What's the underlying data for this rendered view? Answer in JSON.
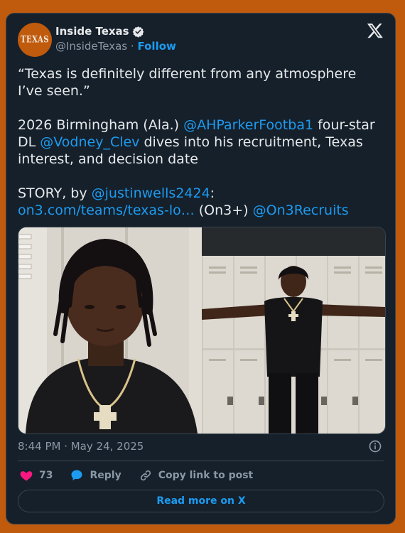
{
  "author": {
    "display_name": "Inside Texas",
    "handle": "@InsideTexas",
    "separator": "·",
    "follow_label": "Follow",
    "avatar_text": "TEXAS"
  },
  "tweet": {
    "quote": "“Texas is definitely different from any atmosphere I’ve seen.”",
    "line2_a": "2026 Birmingham (Ala.) ",
    "line2_mention1": "@AHParkerFootba1",
    "line2_b": " four-star DL ",
    "line2_mention2": "@Vodney_Clev",
    "line2_c": " dives into his recruitment, Texas interest, and decision date",
    "line3_a": "STORY, by ",
    "line3_mention": "@justinwells2424",
    "line3_b": ":",
    "line3_link": "on3.com/teams/texas-lo…",
    "line3_c": " (On3+) ",
    "line3_mention2": "@On3Recruits"
  },
  "meta": {
    "timestamp": "8:44 PM · May 24, 2025"
  },
  "actions": {
    "like_count": "73",
    "reply_label": "Reply",
    "copy_label": "Copy link to post"
  },
  "footer": {
    "read_more_label": "Read more on X"
  },
  "colors": {
    "background": "#c05a0c",
    "card": "#15202b",
    "accent": "#1d9bf0",
    "like": "#f91880"
  }
}
